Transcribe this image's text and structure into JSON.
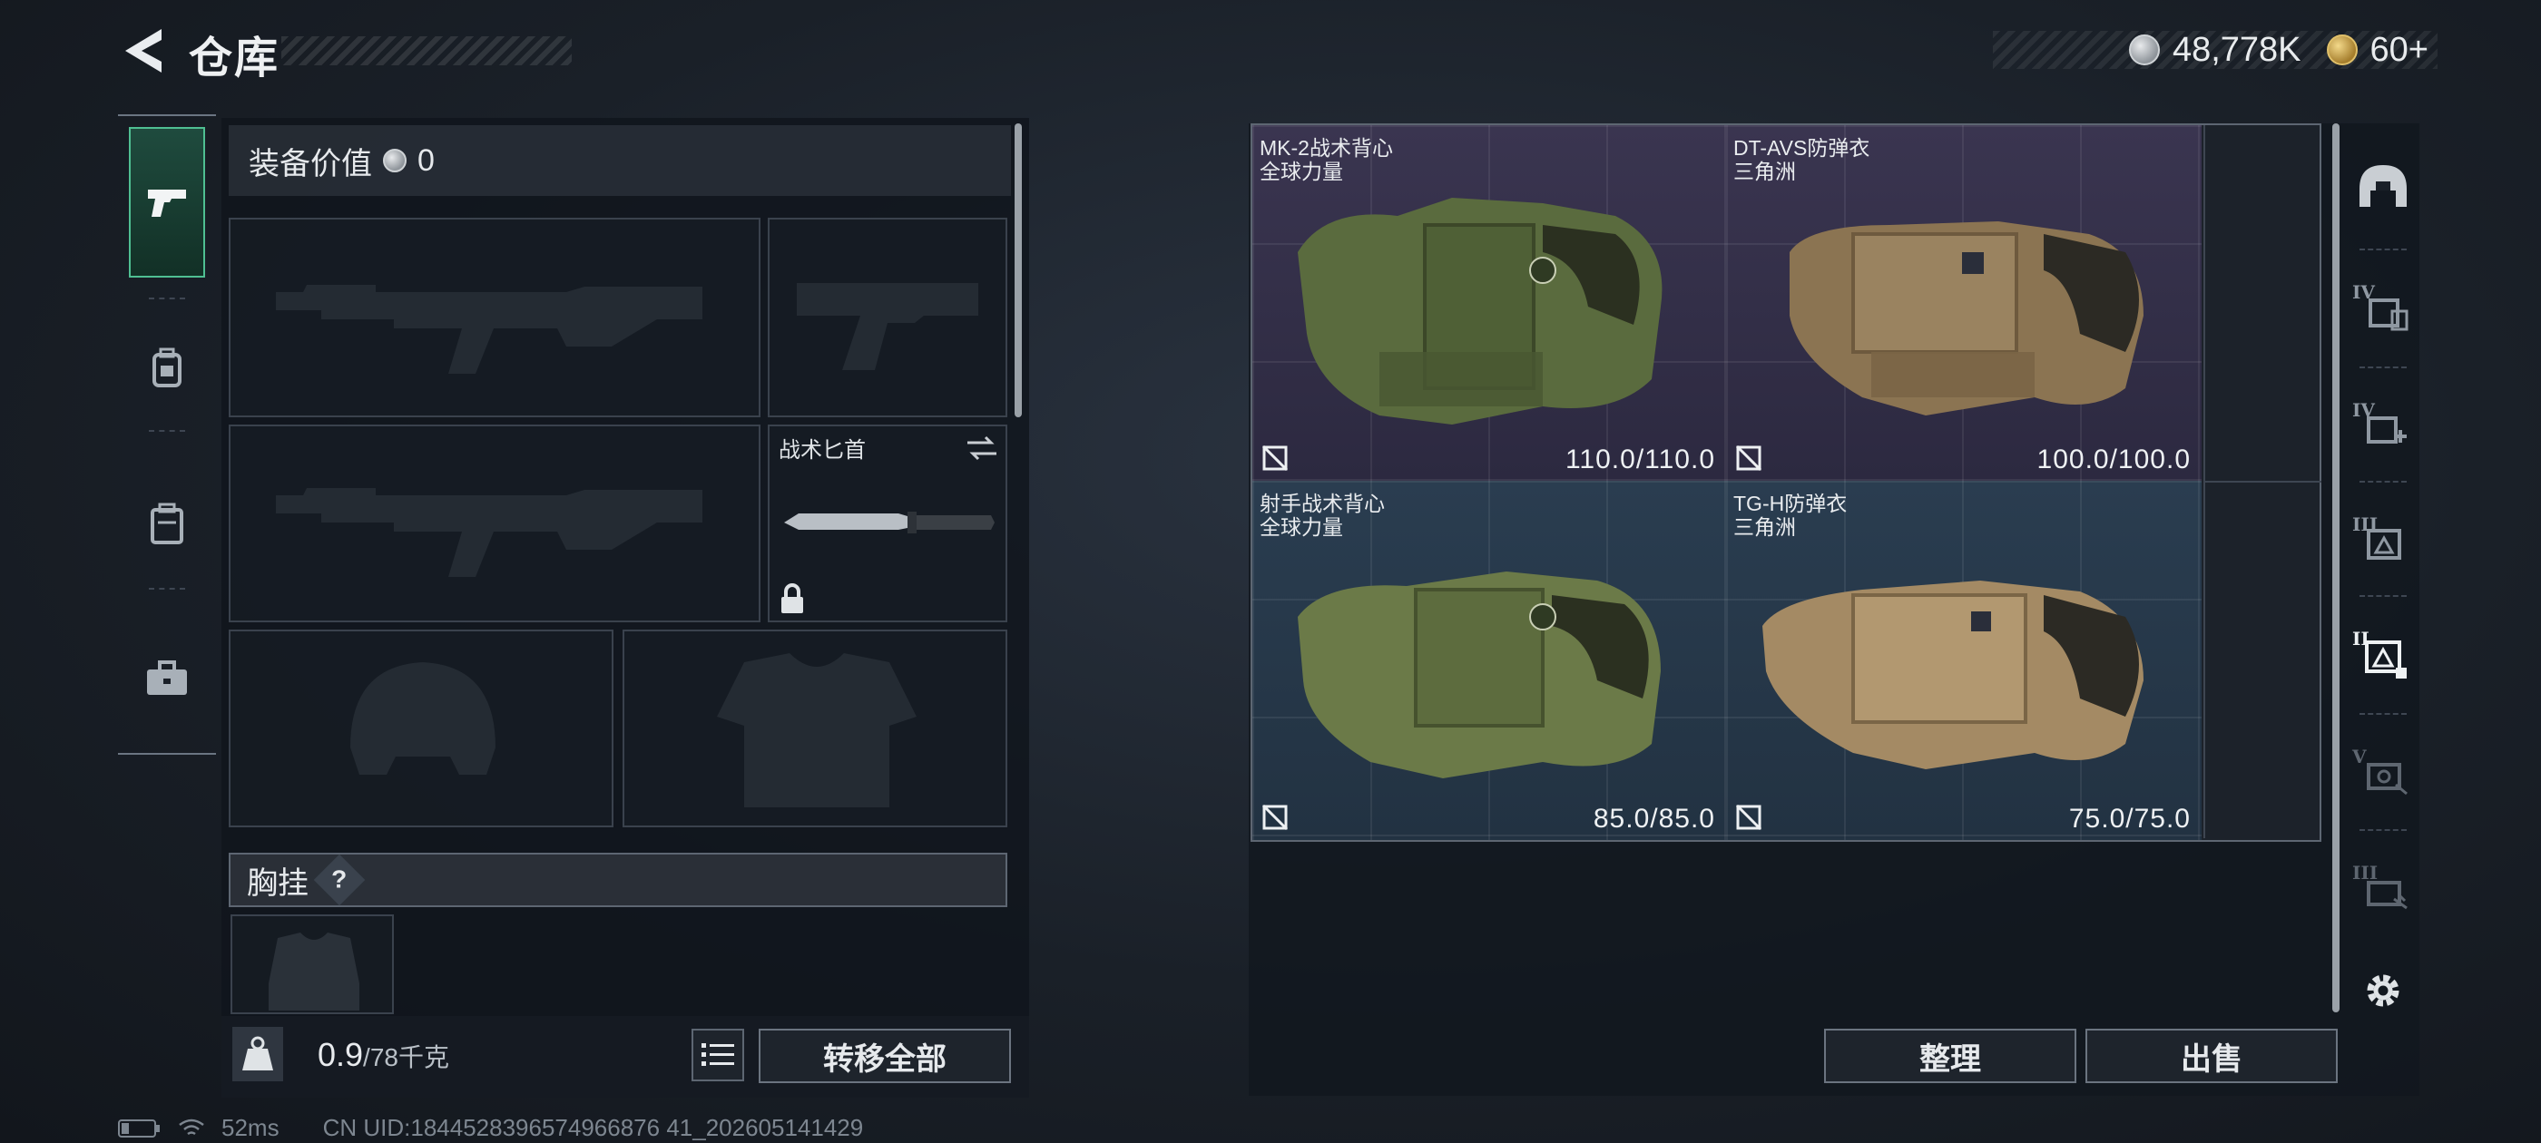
{
  "header": {
    "title": "仓库",
    "currency_silver": "48,778K",
    "currency_gold": "60+"
  },
  "categories": [
    {
      "icon": "pistol-icon",
      "active": true
    },
    {
      "icon": "backpack-icon",
      "active": false
    },
    {
      "icon": "case-icon",
      "active": false
    },
    {
      "icon": "toolbox-icon",
      "active": false
    }
  ],
  "loadout": {
    "equip_value_label": "装备价值",
    "equip_value": "0",
    "melee_slot_label": "战术匕首",
    "chest_rig_label": "胸挂",
    "chest_rig_help": "?",
    "weight_current": "0.9",
    "weight_max": "/78千克",
    "transfer_all_label": "转移全部"
  },
  "status": {
    "ping": "52ms",
    "uid": "CN UID:1844528396574966876 41_202605141429"
  },
  "stash_items": [
    {
      "name": "MK-2战术背心",
      "origin": "全球力量",
      "durability": "110.0/110.0",
      "rarity": "purple"
    },
    {
      "name": "DT-AVS防弹衣",
      "origin": "三角洲",
      "durability": "100.0/100.0",
      "rarity": "purple"
    },
    {
      "name": "射手战术背心",
      "origin": "全球力量",
      "durability": "85.0/85.0",
      "rarity": "blue"
    },
    {
      "name": "TG-H防弹衣",
      "origin": "三角洲",
      "durability": "75.0/75.0",
      "rarity": "blue"
    }
  ],
  "actions": {
    "sort_label": "整理",
    "sell_label": "出售"
  },
  "filters": [
    {
      "icon": "helmet-filter-icon",
      "tier": ""
    },
    {
      "icon": "armor-tier4-filter-icon",
      "tier": "IV"
    },
    {
      "icon": "medkit-tier4-filter-icon",
      "tier": "IV"
    },
    {
      "icon": "armor-tier3-filter-icon",
      "tier": "III"
    },
    {
      "icon": "armor-tier2-filter-icon",
      "tier": "II"
    },
    {
      "icon": "key-tier5-filter-icon",
      "tier": "V"
    },
    {
      "icon": "key-tier3-filter-icon",
      "tier": "III"
    },
    {
      "icon": "settings-icon",
      "tier": ""
    }
  ],
  "colors": {
    "accent_green": "#4fbf92",
    "rarity_purple": "#3a3550",
    "rarity_blue": "#2a3d50"
  }
}
